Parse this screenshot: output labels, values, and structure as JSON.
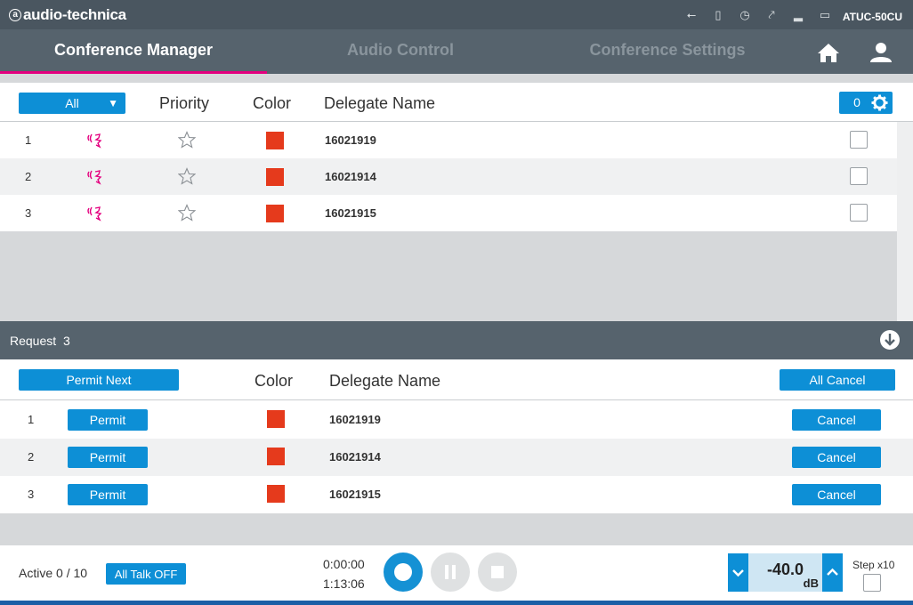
{
  "topbar": {
    "brand": "audio-technica",
    "logo_glyph": "a",
    "model": "ATUC-50CU",
    "status_icons": [
      "usb-icon",
      "sd-card-icon",
      "clock-icon",
      "antenna-icon",
      "signal-icon",
      "battery-icon"
    ]
  },
  "tabs": [
    {
      "label": "Conference Manager",
      "active": true
    },
    {
      "label": "Audio Control",
      "active": false
    },
    {
      "label": "Conference Settings",
      "active": false
    }
  ],
  "delegate_list": {
    "filter_value": "All",
    "headers": {
      "priority": "Priority",
      "color": "Color",
      "delegate_name": "Delegate Name"
    },
    "selected_count": "0",
    "rows": [
      {
        "num": "1",
        "name": "16021919",
        "color": "#e53a1c"
      },
      {
        "num": "2",
        "name": "16021914",
        "color": "#e53a1c"
      },
      {
        "num": "3",
        "name": "16021915",
        "color": "#e53a1c"
      }
    ]
  },
  "request": {
    "label": "Request",
    "count": "3",
    "permit_next_label": "Permit Next",
    "headers": {
      "color": "Color",
      "delegate_name": "Delegate Name"
    },
    "all_cancel_label": "All Cancel",
    "permit_label": "Permit",
    "cancel_label": "Cancel",
    "rows": [
      {
        "num": "1",
        "name": "16021919",
        "color": "#e53a1c"
      },
      {
        "num": "2",
        "name": "16021914",
        "color": "#e53a1c"
      },
      {
        "num": "3",
        "name": "16021915",
        "color": "#e53a1c"
      }
    ]
  },
  "footer": {
    "active_text": "Active 0 / 10",
    "all_talk_off_label": "All Talk OFF",
    "elapsed_time": "0:00:00",
    "remaining_time": "1:13:06",
    "level_value": "-40.0",
    "level_unit": "dB",
    "step_label": "Step x10"
  },
  "colors": {
    "accent": "#0d8fd6",
    "header_bg": "#56636d",
    "active_tab_underline": "#e4007f",
    "talk_icon": "#e4007f",
    "delegate_color": "#e53a1c"
  }
}
